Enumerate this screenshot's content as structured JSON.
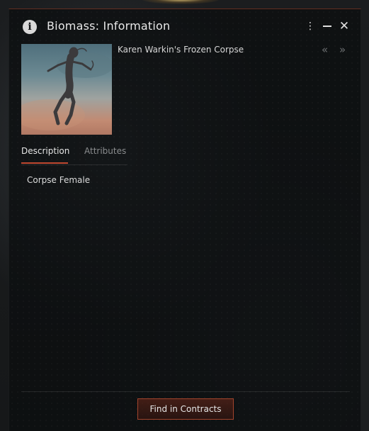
{
  "window": {
    "title": "Biomass: Information",
    "menu_icon": "⋮",
    "minimize_icon": "minimize-icon",
    "close_icon": "✕"
  },
  "item": {
    "name": "Karen Warkin's Frozen Corpse",
    "nav_back": "«",
    "nav_forward": "»"
  },
  "tabs": [
    {
      "label": "Description",
      "active": true
    },
    {
      "label": "Attributes",
      "active": false
    }
  ],
  "description": "Corpse Female",
  "footer": {
    "button_label": "Find in Contracts"
  },
  "colors": {
    "accent": "#c04830",
    "button_border": "#a2442c"
  }
}
